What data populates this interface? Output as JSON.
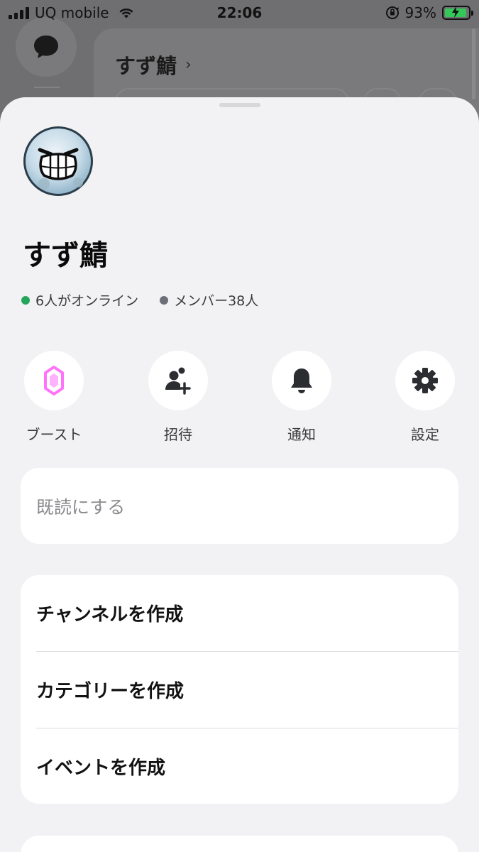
{
  "status_bar": {
    "carrier": "UQ mobile",
    "time": "22:06",
    "battery": "93%",
    "battery_level": 0.93,
    "icons": [
      "signal-icon",
      "wifi-icon",
      "orientation-lock-icon",
      "battery-charging-icon"
    ]
  },
  "background": {
    "server_title": "すず鯖",
    "chevron": "›"
  },
  "sheet": {
    "server_name": "すず鯖",
    "online": "6人がオンライン",
    "members": "メンバー38人",
    "colors": {
      "online": "#23a55a",
      "members": "#6d6f78",
      "boost": "#ff73fa"
    },
    "actions": [
      {
        "label": "ブースト",
        "icon": "boost-gem-icon"
      },
      {
        "label": "招待",
        "icon": "invite-person-add-icon"
      },
      {
        "label": "通知",
        "icon": "bell-icon"
      },
      {
        "label": "設定",
        "icon": "gear-icon"
      }
    ],
    "mark_read": "既読にする",
    "create_items": [
      "チャンネルを作成",
      "カテゴリーを作成",
      "イベントを作成"
    ]
  }
}
